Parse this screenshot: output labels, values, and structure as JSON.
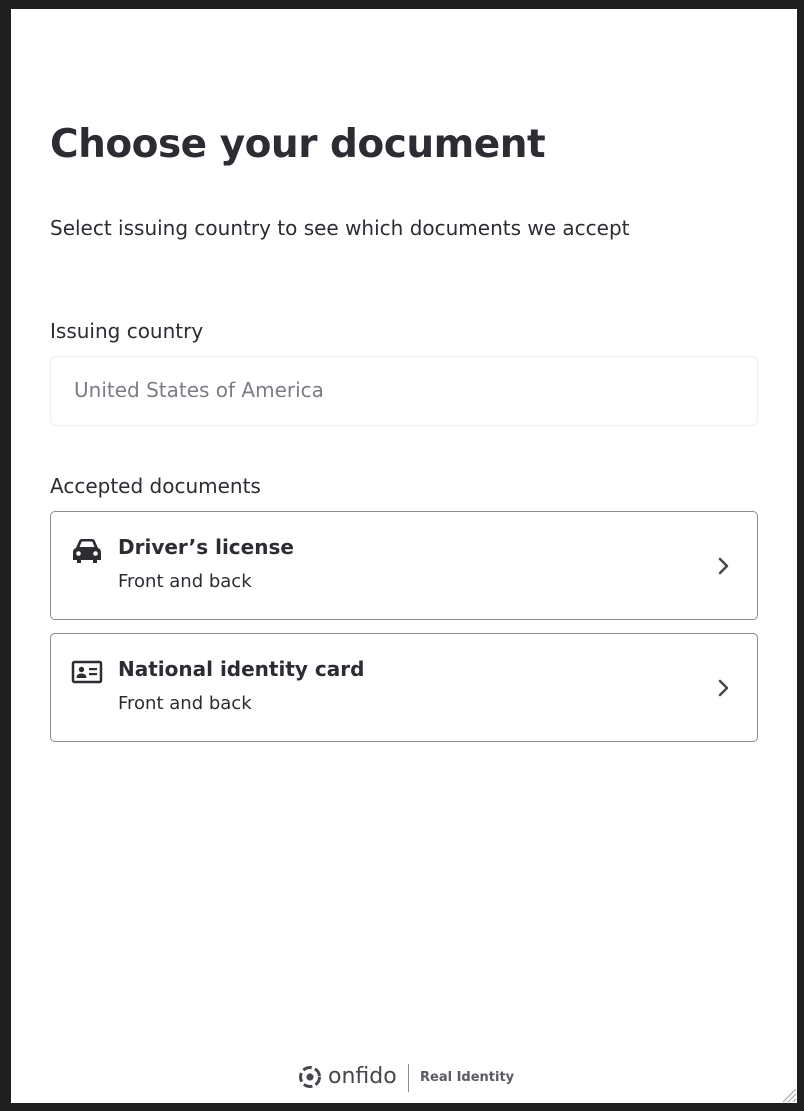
{
  "page": {
    "title": "Choose your document",
    "subtitle": "Select issuing country to see which documents we accept"
  },
  "country_field": {
    "label": "Issuing country",
    "value": "United States of America"
  },
  "accepted_documents": {
    "label": "Accepted documents",
    "items": [
      {
        "title": "Driver’s license",
        "description": "Front and back",
        "icon": "car-icon"
      },
      {
        "title": "National identity card",
        "description": "Front and back",
        "icon": "id-card-icon"
      }
    ]
  },
  "footer": {
    "brand": "onfido",
    "tagline": "Real Identity"
  },
  "colors": {
    "text": "#2b2d33",
    "muted": "#7a7d85",
    "border": "#8a8c92",
    "background": "#ffffff"
  }
}
